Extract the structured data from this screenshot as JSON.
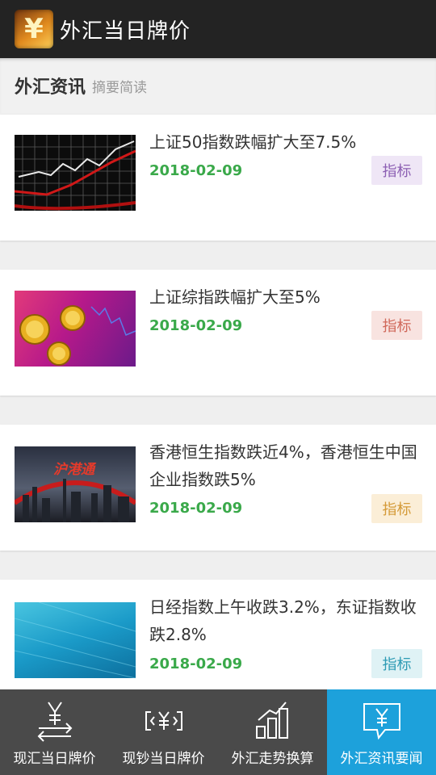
{
  "app": {
    "title": "外汇当日牌价",
    "logo_glyph": "¥"
  },
  "section": {
    "title": "外汇资讯",
    "subtitle": "摘要简读"
  },
  "news": [
    {
      "title": "上证50指数跌幅扩大至7.5%",
      "date": "2018-02-09",
      "tag": "指标",
      "tag_bg": "#efe6f6",
      "tag_color": "#8c5fb3",
      "thumb": "stock-chart-thumbnail"
    },
    {
      "title": "上证综指跌幅扩大至5%",
      "date": "2018-02-09",
      "tag": "指标",
      "tag_bg": "#f8e3e0",
      "tag_color": "#d0685a",
      "thumb": "gold-coins-thumbnail"
    },
    {
      "title": "香港恒生指数跌近4%，香港恒生中国企业指数跌5%",
      "date": "2018-02-09",
      "tag": "指标",
      "tag_bg": "#fbeed7",
      "tag_color": "#d49a37",
      "thumb": "shanghai-hk-connect-thumbnail",
      "thumb_text": "沪港通"
    },
    {
      "title": "日经指数上午收跌3.2%，东证指数收跌2.8%",
      "date": "2018-02-09",
      "tag": "指标",
      "tag_bg": "#dff2f5",
      "tag_color": "#2d9bb4",
      "thumb": "blue-abstract-thumbnail"
    }
  ],
  "bottom_nav": [
    {
      "label": "现汇当日牌价",
      "icon": "yen-exchange-icon",
      "active": false
    },
    {
      "label": "现钞当日牌价",
      "icon": "yen-banknote-icon",
      "active": false
    },
    {
      "label": "外汇走势换算",
      "icon": "bar-trend-icon",
      "active": false
    },
    {
      "label": "外汇资讯要闻",
      "icon": "yen-message-icon",
      "active": true
    }
  ],
  "colors": {
    "appbar": "#232323",
    "date_green": "#3aa94a",
    "nav_active": "#1da1db",
    "nav_bg": "#4a4a4a"
  }
}
